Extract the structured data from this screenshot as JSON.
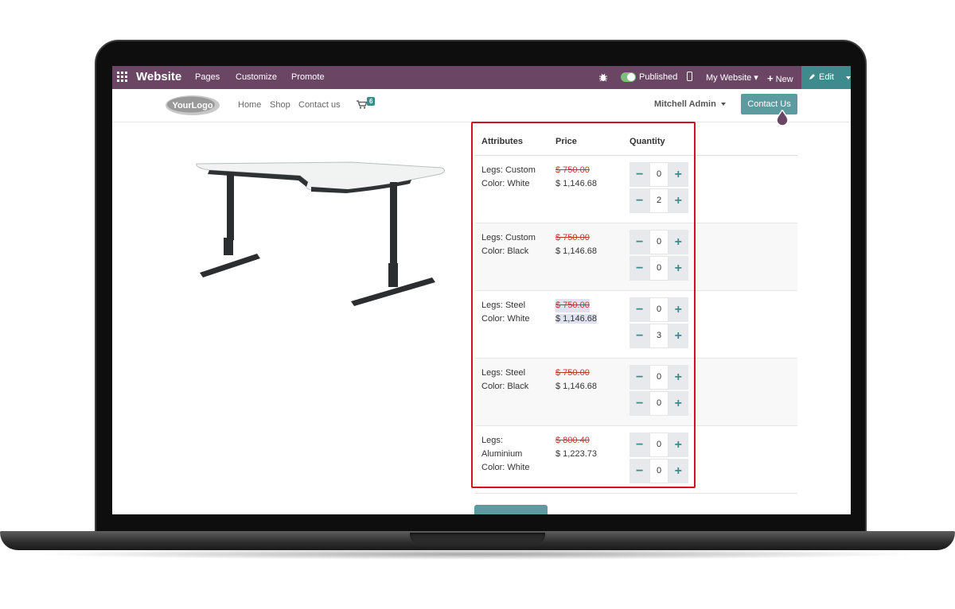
{
  "admin_bar": {
    "app_name": "Website",
    "menu": [
      "Pages",
      "Customize",
      "Promote"
    ],
    "published_label": "Published",
    "website_label": "My Website ▾",
    "new_label": "New",
    "edit_label": "Edit"
  },
  "site_header": {
    "logo_text": "YourLogo",
    "nav": [
      "Home",
      "Shop",
      "Contact us"
    ],
    "cart_count": "6",
    "user_name": "Mitchell Admin",
    "contact_button": "Contact Us"
  },
  "variants_table": {
    "headers": [
      "Attributes",
      "Price",
      "Quantity"
    ],
    "rows": [
      {
        "attr1": "Legs: Custom",
        "attr2": "Color: White",
        "attr3": "",
        "old_price": "$ 750.00",
        "price": "$ 1,146.68",
        "qty_top": "0",
        "qty_bottom": "2"
      },
      {
        "attr1": "Legs: Custom",
        "attr2": "Color: Black",
        "attr3": "",
        "old_price": "$ 750.00",
        "price": "$ 1,146.68",
        "qty_top": "0",
        "qty_bottom": "0"
      },
      {
        "attr1": "Legs: Steel",
        "attr2": "Color: White",
        "attr3": "",
        "old_price": "$ 750.00",
        "price": "$ 1,146.68",
        "qty_top": "0",
        "qty_bottom": "3"
      },
      {
        "attr1": "Legs: Steel",
        "attr2": "Color: Black",
        "attr3": "",
        "old_price": "$ 750.00",
        "price": "$ 1,146.68",
        "qty_top": "0",
        "qty_bottom": "0"
      },
      {
        "attr1": "Legs:",
        "attr2": "Aluminium",
        "attr3": "Color: White",
        "old_price": "$ 800.40",
        "price": "$ 1,223.73",
        "qty_top": "0",
        "qty_bottom": "0"
      }
    ]
  },
  "colors": {
    "admin_bar": "#6b4664",
    "accent": "#3f8a8c",
    "highlight_box": "#d0121b",
    "strike_price": "#c0392b"
  }
}
